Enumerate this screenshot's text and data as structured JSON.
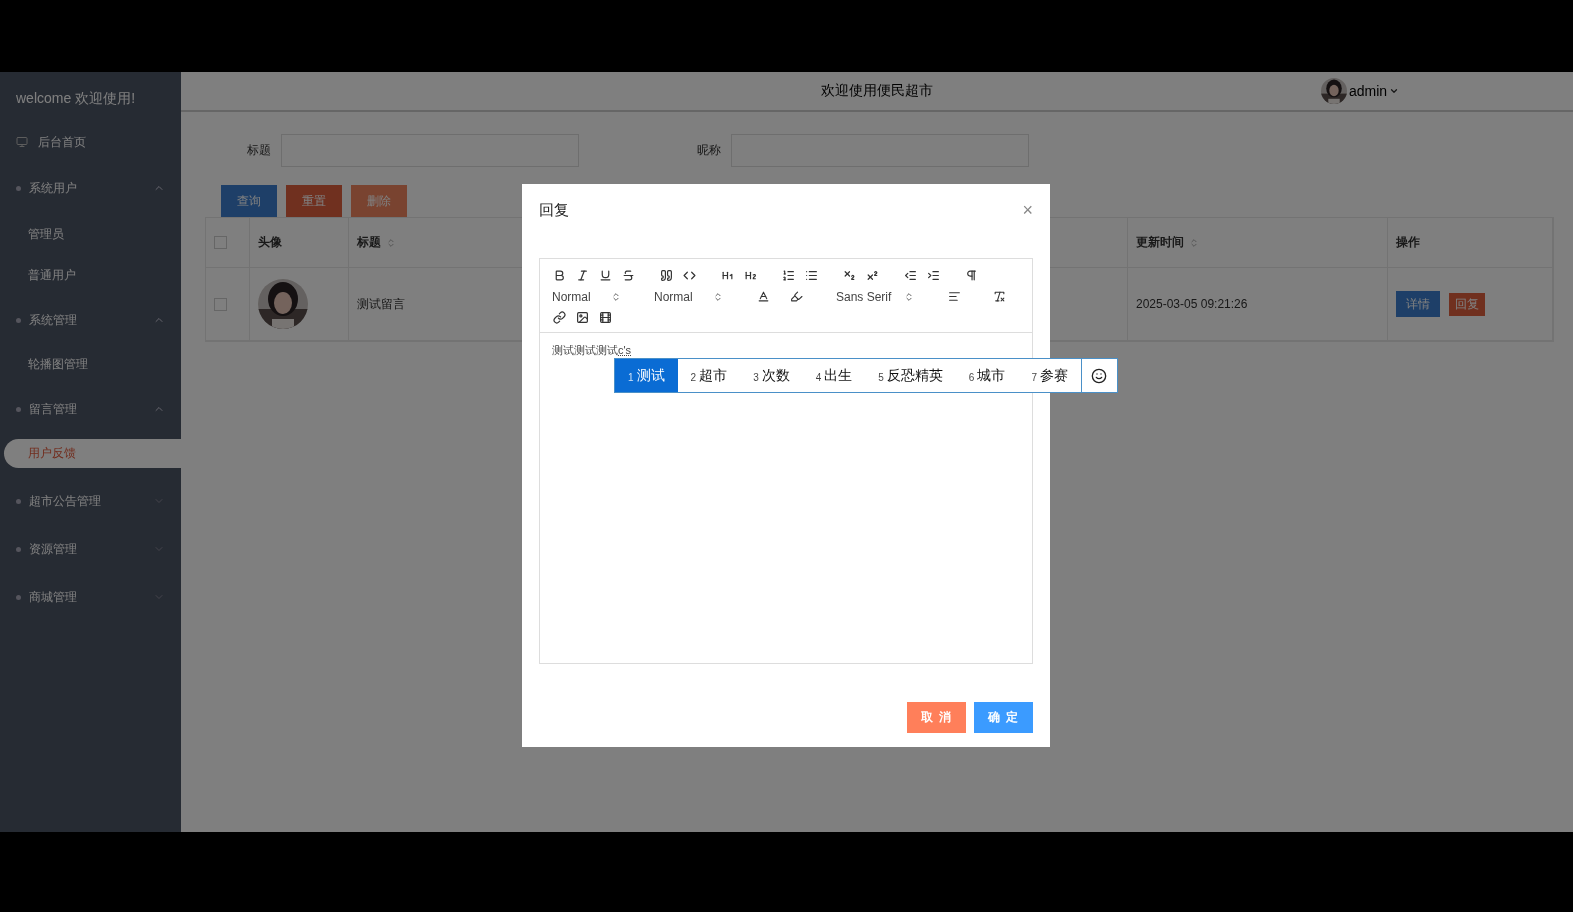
{
  "sidebar": {
    "title": "welcome 欢迎使用!",
    "items": [
      {
        "label": "后台首页",
        "kind": "link"
      },
      {
        "label": "系统用户",
        "kind": "group",
        "expanded": true,
        "children": [
          {
            "label": "管理员",
            "selected": false
          },
          {
            "label": "普通用户",
            "selected": false
          }
        ]
      },
      {
        "label": "系统管理",
        "kind": "group",
        "expanded": true,
        "children": [
          {
            "label": "轮播图管理",
            "selected": false
          }
        ]
      },
      {
        "label": "留言管理",
        "kind": "group",
        "expanded": true,
        "children": [
          {
            "label": "用户反馈",
            "selected": true
          }
        ]
      },
      {
        "label": "超市公告管理",
        "kind": "group",
        "expanded": false
      },
      {
        "label": "资源管理",
        "kind": "group",
        "expanded": false
      },
      {
        "label": "商城管理",
        "kind": "group",
        "expanded": false
      }
    ]
  },
  "header": {
    "title": "欢迎使用便民超市",
    "user": "admin"
  },
  "search": {
    "fields": [
      {
        "label": "标题"
      },
      {
        "label": "昵称"
      }
    ],
    "buttons": [
      {
        "label": "查询",
        "kind": "primary"
      },
      {
        "label": "重置",
        "kind": "danger"
      },
      {
        "label": "删除",
        "kind": "muted"
      }
    ]
  },
  "table": {
    "columns": [
      {
        "kind": "checkbox",
        "checked": false
      },
      {
        "label": "头像",
        "kind": "plain"
      },
      {
        "label": "标题",
        "kind": "sortable"
      },
      {
        "label": "更新时间",
        "kind": "sortable"
      },
      {
        "label": "操作",
        "kind": "plain"
      }
    ],
    "rows": [
      {
        "checked": false,
        "title": "测试留言",
        "updated": "2025-03-05 09:21:26",
        "actions": [
          {
            "label": "详情",
            "kind": "primary"
          },
          {
            "label": "回复",
            "kind": "danger"
          }
        ]
      }
    ]
  },
  "dialog": {
    "title": "回复",
    "close": "×",
    "toolbar": {
      "selects": [
        {
          "value": "Normal"
        },
        {
          "value": "Normal"
        },
        {
          "value": "Sans Serif"
        }
      ]
    },
    "content": {
      "text": "测试测试测试",
      "composition": "c's"
    },
    "ime": {
      "candidates": [
        {
          "index": "1",
          "text": "测试",
          "selected": true
        },
        {
          "index": "2",
          "text": "超市",
          "selected": false
        },
        {
          "index": "3",
          "text": "次数",
          "selected": false
        },
        {
          "index": "4",
          "text": "出生",
          "selected": false
        },
        {
          "index": "5",
          "text": "反恐精英",
          "selected": false
        },
        {
          "index": "6",
          "text": "城市",
          "selected": false
        },
        {
          "index": "7",
          "text": "参赛",
          "selected": false
        }
      ]
    },
    "buttons": [
      {
        "label": "取 消",
        "kind": "cancel"
      },
      {
        "label": "确 定",
        "kind": "confirm"
      }
    ]
  }
}
